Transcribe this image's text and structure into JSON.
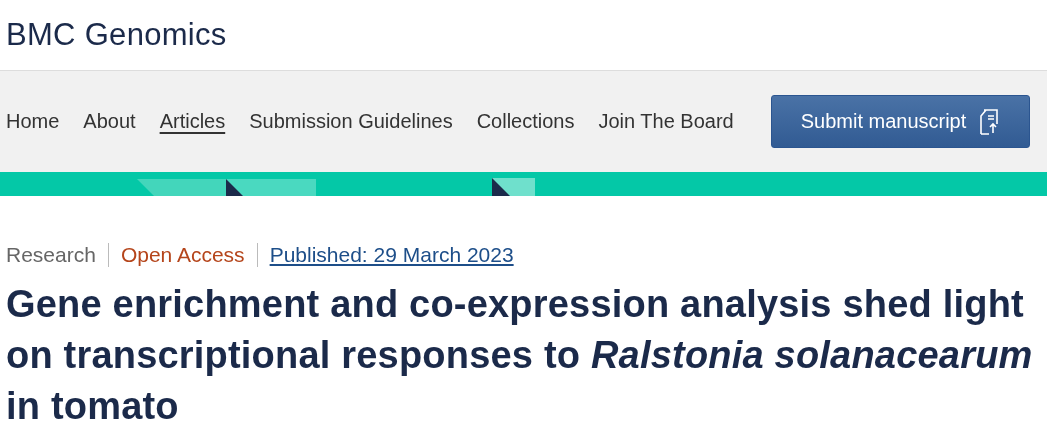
{
  "journal": {
    "title": "BMC Genomics"
  },
  "nav": {
    "items": [
      {
        "label": "Home",
        "selected": false
      },
      {
        "label": "About",
        "selected": false
      },
      {
        "label": "Articles",
        "selected": true
      },
      {
        "label": "Submission Guidelines",
        "selected": false
      },
      {
        "label": "Collections",
        "selected": false
      },
      {
        "label": "Join The Board",
        "selected": false
      }
    ],
    "submit_button": "Submit manuscript"
  },
  "article": {
    "type": "Research",
    "access": "Open Access",
    "published": "Published: 29 March 2023",
    "title": "Gene enrichment and co-expression analysis shed light on transcriptional responses to *Ralstonia solanacearum* in tomato"
  }
}
